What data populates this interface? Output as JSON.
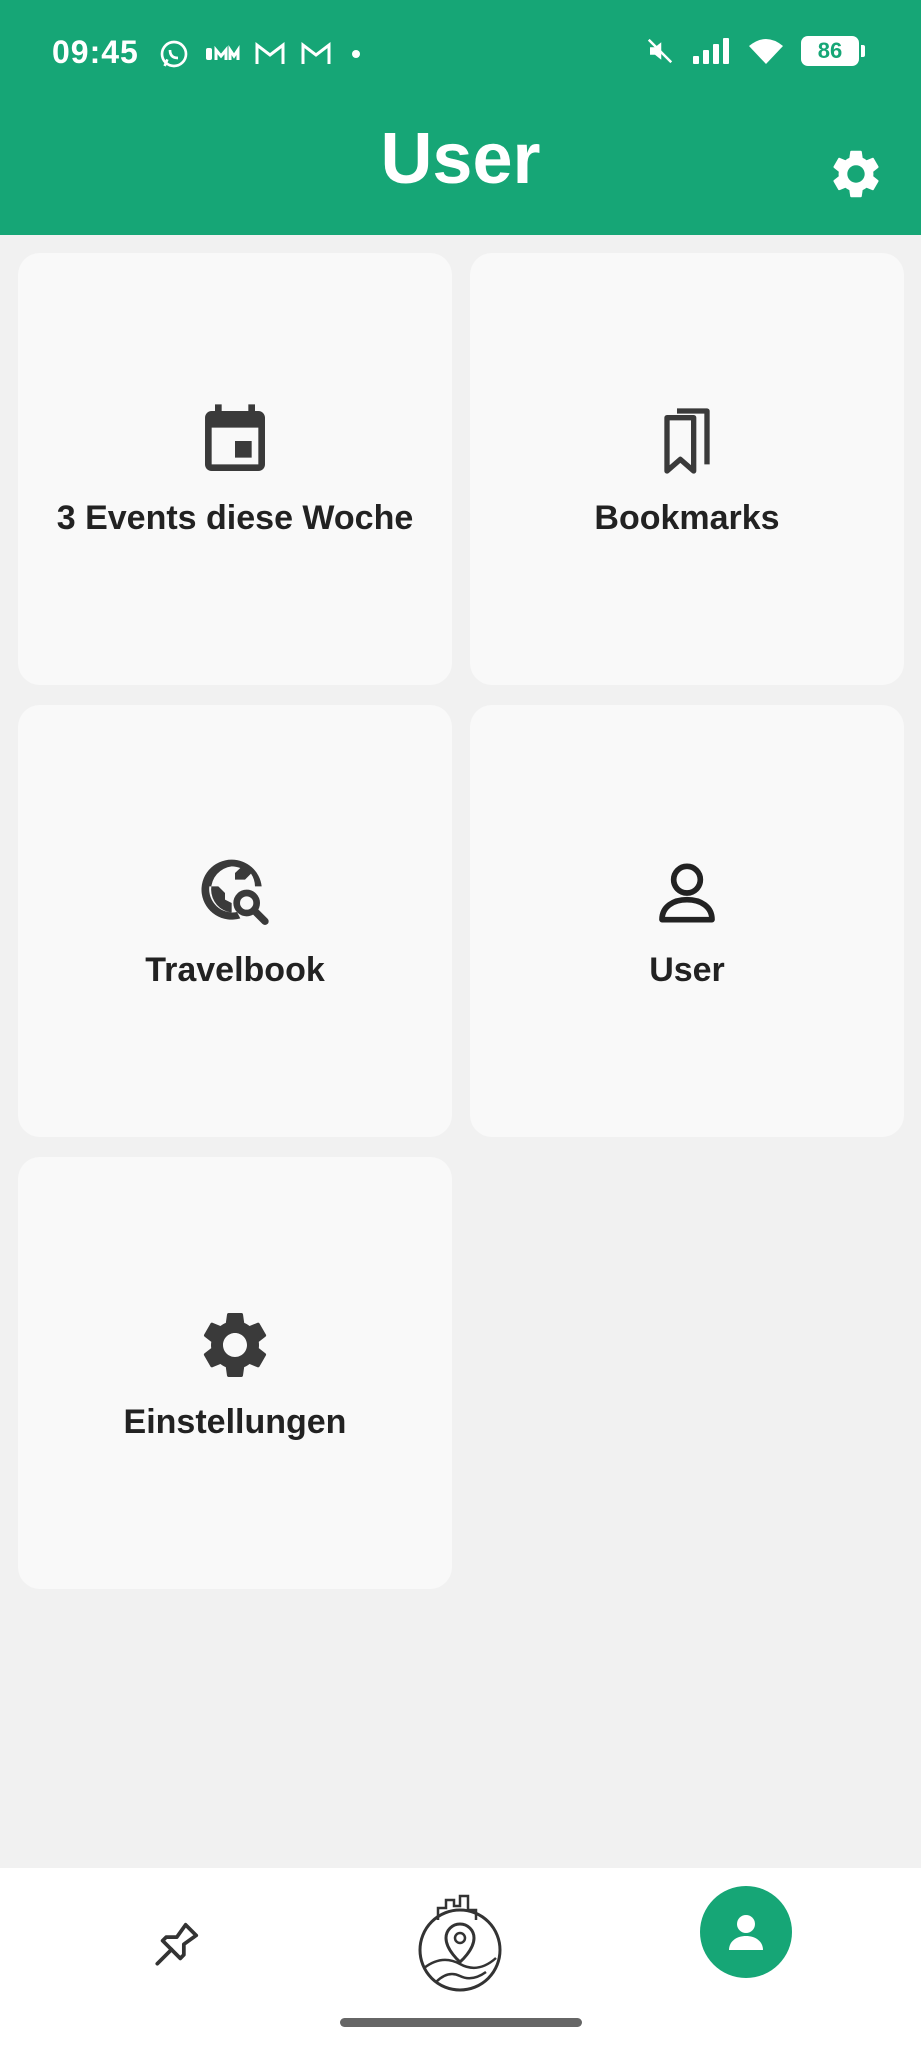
{
  "status_bar": {
    "time": "09:45",
    "battery": "86",
    "icons_left": [
      "whatsapp-icon",
      "carrier-icon",
      "gmail-icon",
      "gmail-icon",
      "dot-icon"
    ],
    "icons_right": [
      "mute-icon",
      "signal-icon",
      "wifi-icon",
      "battery-icon"
    ]
  },
  "header": {
    "title": "User",
    "settings_icon": "gear-icon"
  },
  "cards": {
    "events": {
      "label": "3 Events diese Woche",
      "icon": "calendar-icon"
    },
    "bookmarks": {
      "label": "Bookmarks",
      "icon": "bookmarks-icon"
    },
    "travelbook": {
      "label": "Travelbook",
      "icon": "travel-explore-icon"
    },
    "user": {
      "label": "User",
      "icon": "person-icon"
    },
    "settings": {
      "label": "Einstellungen",
      "icon": "gear-icon"
    }
  },
  "bottom_nav": {
    "items": [
      {
        "name": "pin",
        "icon": "pin-icon",
        "active": false
      },
      {
        "name": "map",
        "icon": "city-map-icon",
        "active": false
      },
      {
        "name": "user",
        "icon": "person-icon",
        "active": true
      }
    ]
  },
  "colors": {
    "primary": "#16a676",
    "background": "#f1f1f1",
    "card": "#f9f9f9",
    "icon": "#3a3a3a"
  }
}
